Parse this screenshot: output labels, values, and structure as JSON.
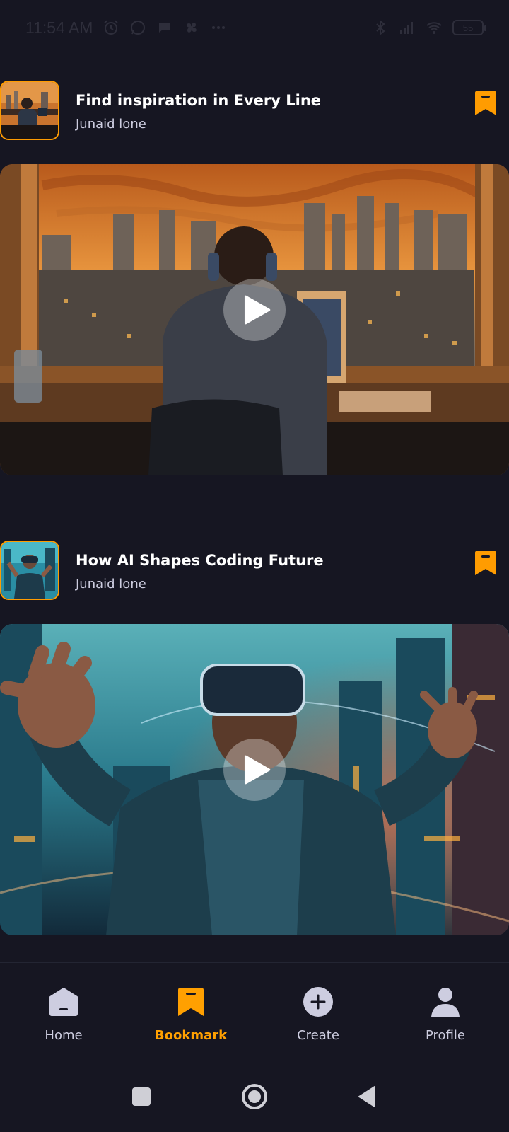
{
  "status_bar": {
    "time": "11:54 AM",
    "battery": "55",
    "icons": [
      "alarm-icon",
      "whatsapp-icon",
      "chat-icon",
      "fan-icon",
      "more-dots-icon",
      "bluetooth-icon",
      "signal-icon",
      "wifi-icon",
      "battery-icon"
    ]
  },
  "posts": [
    {
      "title": "Find inspiration in Every Line",
      "author": "Junaid lone",
      "bookmarked": true,
      "video_icon": "play-icon"
    },
    {
      "title": "How AI Shapes Coding Future",
      "author": "Junaid lone",
      "bookmarked": true,
      "video_icon": "play-icon"
    }
  ],
  "tabs": [
    {
      "label": "Home",
      "icon": "home-icon",
      "active": false
    },
    {
      "label": "Bookmark",
      "icon": "bookmark-icon",
      "active": true
    },
    {
      "label": "Create",
      "icon": "plus-circle-icon",
      "active": false
    },
    {
      "label": "Profile",
      "icon": "profile-icon",
      "active": false
    }
  ],
  "colors": {
    "background": "#161622",
    "accent": "#ff9c01",
    "secondary_text": "#cdcde0"
  },
  "system_nav": [
    "recents-button",
    "home-button",
    "back-button"
  ]
}
